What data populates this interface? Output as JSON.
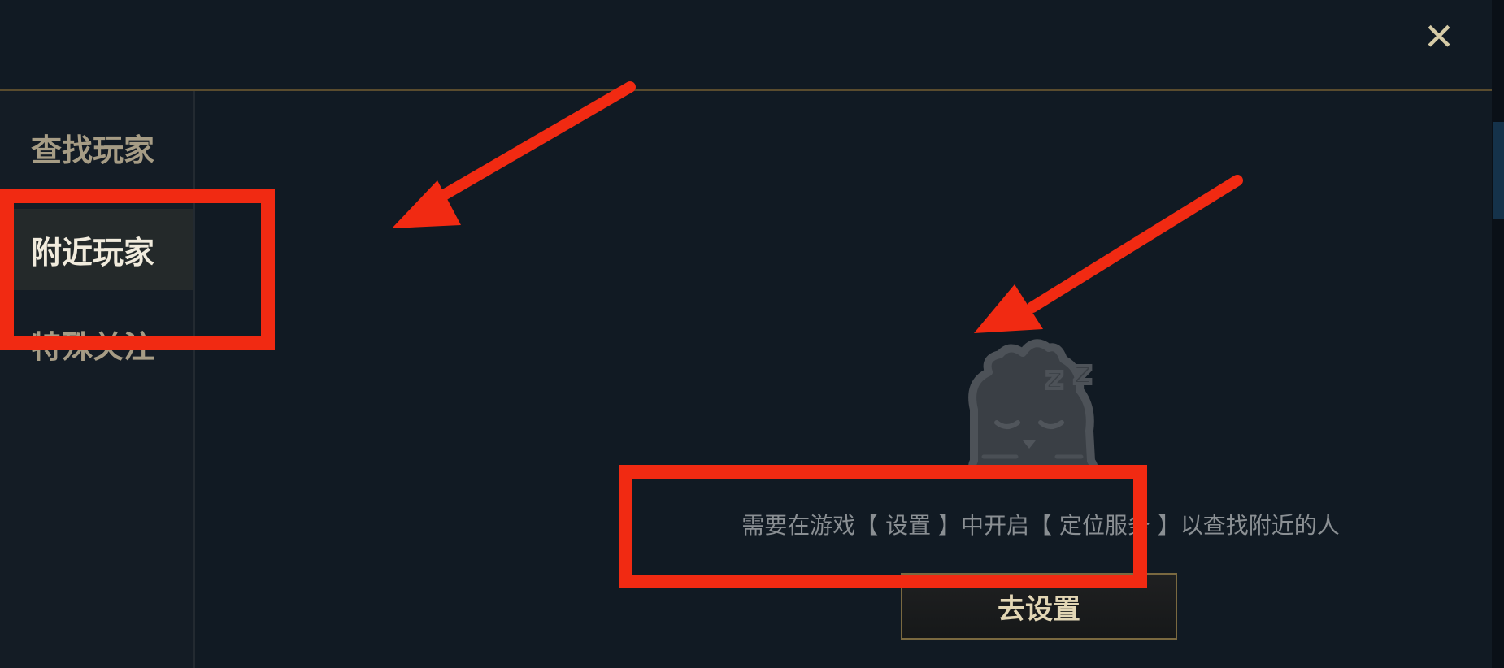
{
  "header": {
    "close_icon": "close-icon"
  },
  "sidebar": {
    "items": [
      {
        "label": "查找玩家",
        "active": false
      },
      {
        "label": "附近玩家",
        "active": true
      },
      {
        "label": "特殊关注",
        "active": false
      }
    ]
  },
  "main": {
    "empty_state_icon": "sleeping-poro-icon",
    "message": "需要在游戏【 设置 】中开启【 定位服务 】以查找附近的人",
    "settings_button_label": "去设置"
  },
  "annotations": {
    "color": "#f12a12",
    "highlighted_targets": [
      "附近玩家",
      "去设置"
    ]
  },
  "colors": {
    "background": "#111a23",
    "accent_gold": "#8b7a55",
    "active_text": "#f1ebdd",
    "inactive_text": "#a69c85"
  }
}
